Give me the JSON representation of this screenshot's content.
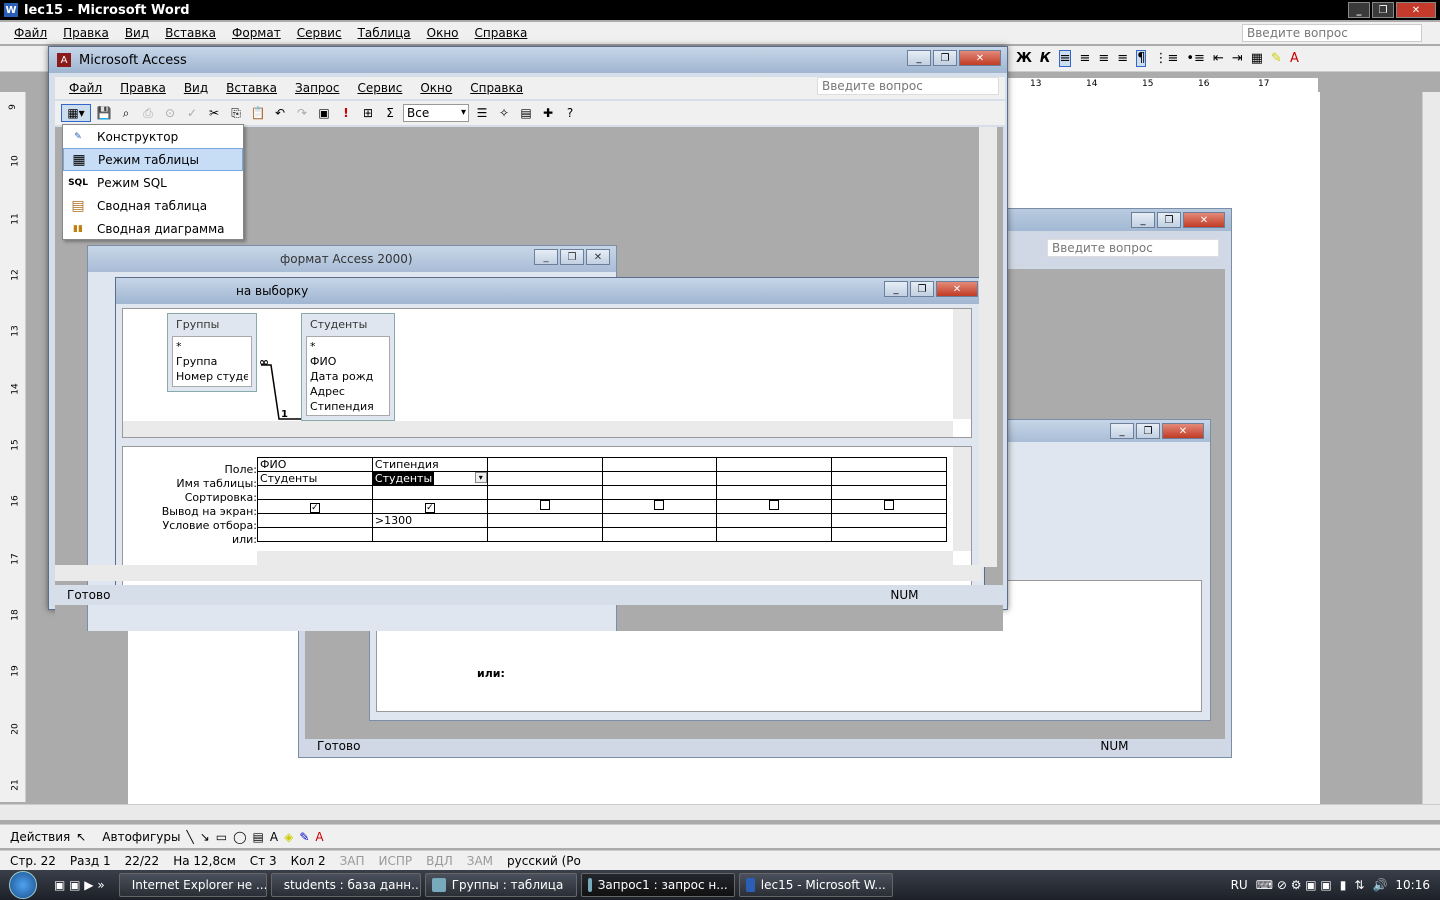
{
  "word": {
    "title": "lec15 - Microsoft Word",
    "menu": [
      "Файл",
      "Правка",
      "Вид",
      "Вставка",
      "Формат",
      "Сервис",
      "Таблица",
      "Окно",
      "Справка"
    ],
    "help_placeholder": "Введите вопрос",
    "ruler_h": [
      "13",
      "14",
      "15",
      "16",
      "17"
    ],
    "ruler_v": [
      "9",
      "10",
      "11",
      "12",
      "13",
      "14",
      "15",
      "16",
      "17",
      "18",
      "19",
      "20",
      "21"
    ],
    "draw_actions": "Действия",
    "draw_shapes": "Автофигуры",
    "status": {
      "page": "Стр. 22",
      "section": "Разд 1",
      "pages": "22/22",
      "at": "На 12,8см",
      "line": "Ст 3",
      "col": "Кол 2",
      "rec": "ЗАП",
      "trk": "ИСПР",
      "ext": "ВДЛ",
      "ovr": "ЗАМ",
      "lang": "русский (Ро"
    }
  },
  "taskbar": {
    "buttons": [
      {
        "label": "Internet Explorer не ...",
        "active": false
      },
      {
        "label": "students : база данн...",
        "active": false
      },
      {
        "label": "Группы : таблица",
        "active": false
      },
      {
        "label": "Запрос1 : запрос н...",
        "active": true
      },
      {
        "label": "lec15 - Microsoft W...",
        "active": false
      }
    ],
    "lang": "RU",
    "clock": "10:16"
  },
  "back_access": {
    "help_placeholder": "Введите вопрос",
    "status": "Готово",
    "num": "NUM",
    "label_or": "или:"
  },
  "access": {
    "title": "Microsoft Access",
    "menu": [
      "Файл",
      "Правка",
      "Вид",
      "Вставка",
      "Запрос",
      "Сервис",
      "Окно",
      "Справка"
    ],
    "help_placeholder": "Введите вопрос",
    "combo_value": "Все",
    "status": "Готово",
    "num": "NUM"
  },
  "db_window": {
    "title": "формат Access 2000)"
  },
  "query_window": {
    "title": "на выборку",
    "tables": [
      {
        "name": "Группы",
        "fields": [
          "*",
          "Группа",
          "Номер студент"
        ]
      },
      {
        "name": "Студенты",
        "fields": [
          "*",
          "ФИО",
          "Дата рожд",
          "Адрес",
          "Стипендия"
        ]
      }
    ],
    "join_many": "∞",
    "join_one": "1",
    "row_labels": [
      "Поле:",
      "Имя таблицы:",
      "Сортировка:",
      "Вывод на экран:",
      "Условие отбора:",
      "или:"
    ],
    "columns": [
      {
        "field": "ФИО",
        "table": "Студенты",
        "show": true,
        "criteria": ""
      },
      {
        "field": "Стипендия",
        "table": "Студенты",
        "show": true,
        "criteria": ">1300"
      },
      {
        "field": "",
        "table": "",
        "show": false,
        "criteria": ""
      },
      {
        "field": "",
        "table": "",
        "show": false,
        "criteria": ""
      },
      {
        "field": "",
        "table": "",
        "show": false,
        "criteria": ""
      },
      {
        "field": "",
        "table": "",
        "show": false,
        "criteria": ""
      }
    ]
  },
  "view_menu": {
    "items": [
      {
        "label": "Конструктор",
        "icon": "design-view-icon",
        "glyph": "✎"
      },
      {
        "label": "Режим таблицы",
        "icon": "datasheet-view-icon",
        "glyph": "▦",
        "selected": true
      },
      {
        "label": "Режим SQL",
        "icon": "sql-view-icon",
        "glyph": "SQL"
      },
      {
        "label": "Сводная таблица",
        "icon": "pivot-table-icon",
        "glyph": "▤"
      },
      {
        "label": "Сводная диаграмма",
        "icon": "pivot-chart-icon",
        "glyph": "▮▮"
      }
    ]
  }
}
